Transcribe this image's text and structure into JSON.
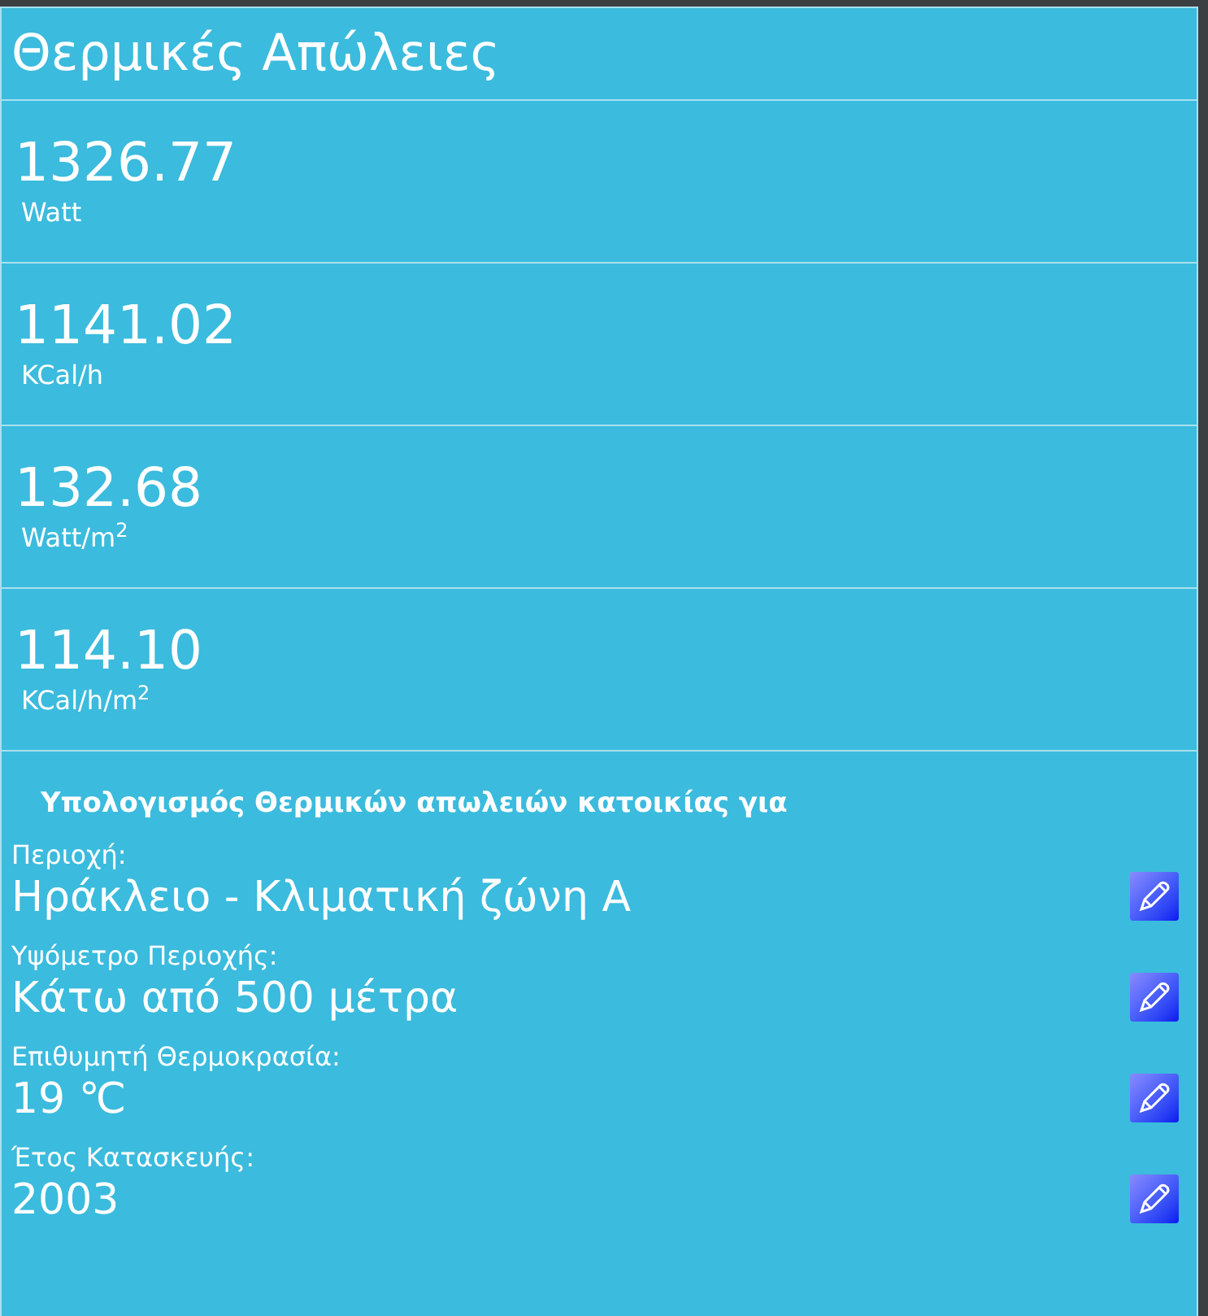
{
  "title": "Θερμικές Απώλειες",
  "results": [
    {
      "value": "1326.77",
      "unit": "Watt"
    },
    {
      "value": "1141.02",
      "unit": "KCal/h"
    },
    {
      "value": "132.68",
      "unit": "Watt/m$^{2}$"
    },
    {
      "value": "114.10",
      "unit": "KCal/h/m$^{2}$"
    }
  ],
  "section_heading": "Υπολογισμός Θερμικών απωλειών κατοικίας για",
  "fields": [
    {
      "label": "Περιοχή:",
      "value": "Ηράκλειο - Κλιματική ζώνη Α"
    },
    {
      "label": "Υψόμετρο Περιοχής:",
      "value": "Κάτω από 500 μέτρα"
    },
    {
      "label": "Επιθυμητή Θερμοκρασία:",
      "value": "19 ℃"
    },
    {
      "label": "Έτος Κατασκευής:",
      "value": "2003"
    }
  ]
}
